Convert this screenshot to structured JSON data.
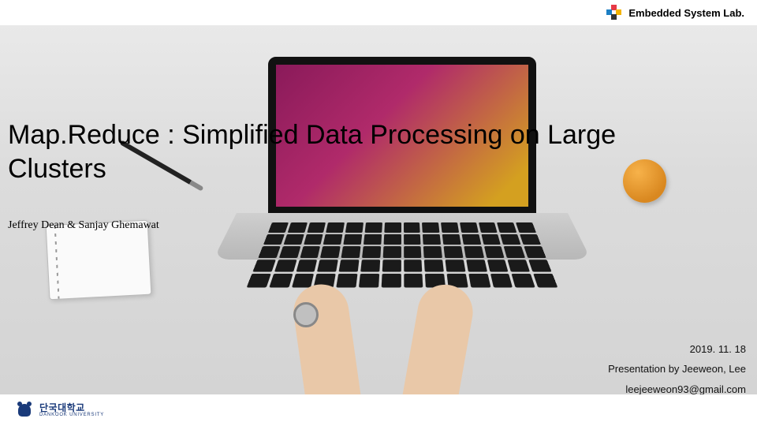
{
  "header": {
    "lab_name": "Embedded System Lab."
  },
  "title": {
    "line1": "Map.Reduce : Simplified Data Processing on Large",
    "line2": "Clusters"
  },
  "authors": "Jeffrey Dean & Sanjay Ghemawat",
  "meta": {
    "date": "2019. 11. 18",
    "presenter": "Presentation by Jeeweon, Lee",
    "email": "leejeeweon93@gmail.com"
  },
  "footer": {
    "university_kr": "단국대학교",
    "university_en": "DANKOOK UNIVERSITY"
  }
}
